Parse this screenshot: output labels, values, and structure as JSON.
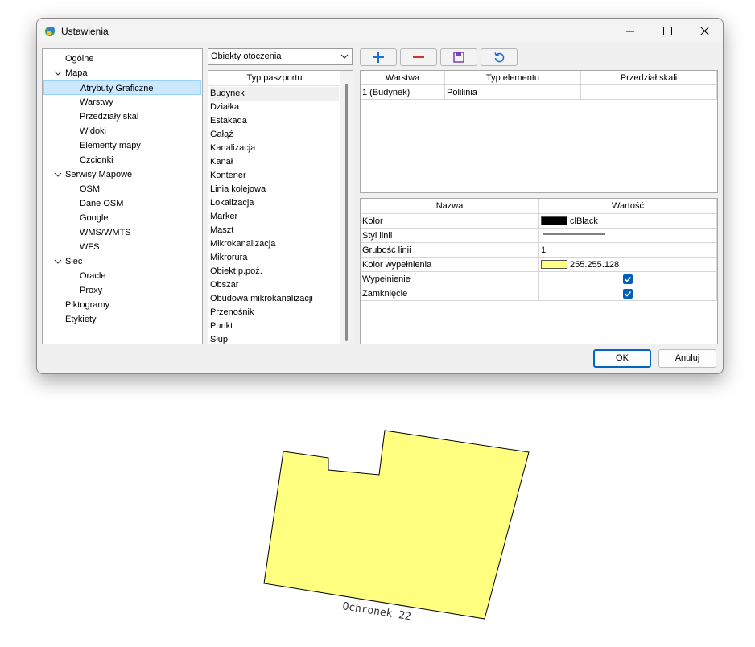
{
  "window": {
    "title": "Ustawienia"
  },
  "tree": {
    "items": [
      {
        "label": "Ogólne",
        "level": 0,
        "expanded": null,
        "selected": false
      },
      {
        "label": "Mapa",
        "level": 0,
        "expanded": true,
        "selected": false
      },
      {
        "label": "Atrybuty Graficzne",
        "level": 1,
        "expanded": null,
        "selected": true
      },
      {
        "label": "Warstwy",
        "level": 1,
        "expanded": null,
        "selected": false
      },
      {
        "label": "Przedziały skal",
        "level": 1,
        "expanded": null,
        "selected": false
      },
      {
        "label": "Widoki",
        "level": 1,
        "expanded": null,
        "selected": false
      },
      {
        "label": "Elementy mapy",
        "level": 1,
        "expanded": null,
        "selected": false
      },
      {
        "label": "Czcionki",
        "level": 1,
        "expanded": null,
        "selected": false
      },
      {
        "label": "Serwisy Mapowe",
        "level": 0,
        "expanded": true,
        "selected": false
      },
      {
        "label": "OSM",
        "level": 1,
        "expanded": null,
        "selected": false
      },
      {
        "label": "Dane OSM",
        "level": 1,
        "expanded": null,
        "selected": false
      },
      {
        "label": "Google",
        "level": 1,
        "expanded": null,
        "selected": false
      },
      {
        "label": "WMS/WMTS",
        "level": 1,
        "expanded": null,
        "selected": false
      },
      {
        "label": "WFS",
        "level": 1,
        "expanded": null,
        "selected": false
      },
      {
        "label": "Sieć",
        "level": 0,
        "expanded": true,
        "selected": false
      },
      {
        "label": "Oracle",
        "level": 1,
        "expanded": null,
        "selected": false
      },
      {
        "label": "Proxy",
        "level": 1,
        "expanded": null,
        "selected": false
      },
      {
        "label": "Piktogramy",
        "level": 0,
        "expanded": null,
        "selected": false
      },
      {
        "label": "Etykiety",
        "level": 0,
        "expanded": null,
        "selected": false
      }
    ]
  },
  "category_select": {
    "value": "Obiekty otoczenia"
  },
  "toolbar": {
    "buttons": [
      {
        "name": "add-button",
        "icon": "plus-icon",
        "color": "#1f6fd1"
      },
      {
        "name": "remove-button",
        "icon": "minus-icon",
        "color": "#d0312d"
      },
      {
        "name": "save-button",
        "icon": "floppy-disk-icon",
        "color": "#7b3fb5"
      },
      {
        "name": "refresh-button",
        "icon": "refresh-icon",
        "color": "#1f6fd1"
      }
    ]
  },
  "passport_list": {
    "header": "Typ paszportu",
    "items": [
      "Budynek",
      "Działka",
      "Estakada",
      "Gałąź",
      "Kanalizacja",
      "Kanał",
      "Kontener",
      "Linia kolejowa",
      "Lokalizacja",
      "Marker",
      "Maszt",
      "Mikrokanalizacja",
      "Mikrorura",
      "Obiekt p.poż.",
      "Obszar",
      "Obudowa mikrokanalizacji",
      "Przenośnik",
      "Punkt",
      "Słup"
    ],
    "selected_index": 0
  },
  "layers_grid": {
    "headers": [
      "Warstwa",
      "Typ elementu",
      "Przedział skali"
    ],
    "rows": [
      [
        "1 (Budynek)",
        "Polilinia",
        ""
      ]
    ]
  },
  "props_grid": {
    "headers": [
      "Nazwa",
      "Wartość"
    ],
    "rows": [
      {
        "name": "Kolor",
        "type": "color",
        "swatch": "#000000",
        "value": "clBlack"
      },
      {
        "name": "Styl linii",
        "type": "line",
        "value": ""
      },
      {
        "name": "Grubość linii",
        "type": "text",
        "value": "1"
      },
      {
        "name": "Kolor wypełnienia",
        "type": "color",
        "swatch": "#ffff80",
        "value": "255.255.128"
      },
      {
        "name": "Wypełnienie",
        "type": "check",
        "value": ""
      },
      {
        "name": "Zamknięcie",
        "type": "check",
        "value": ""
      }
    ]
  },
  "buttons": {
    "ok": "OK",
    "cancel": "Anuluj"
  },
  "preview": {
    "label": "Ochronek 22",
    "fill": "#ffff80",
    "stroke": "#000000"
  }
}
